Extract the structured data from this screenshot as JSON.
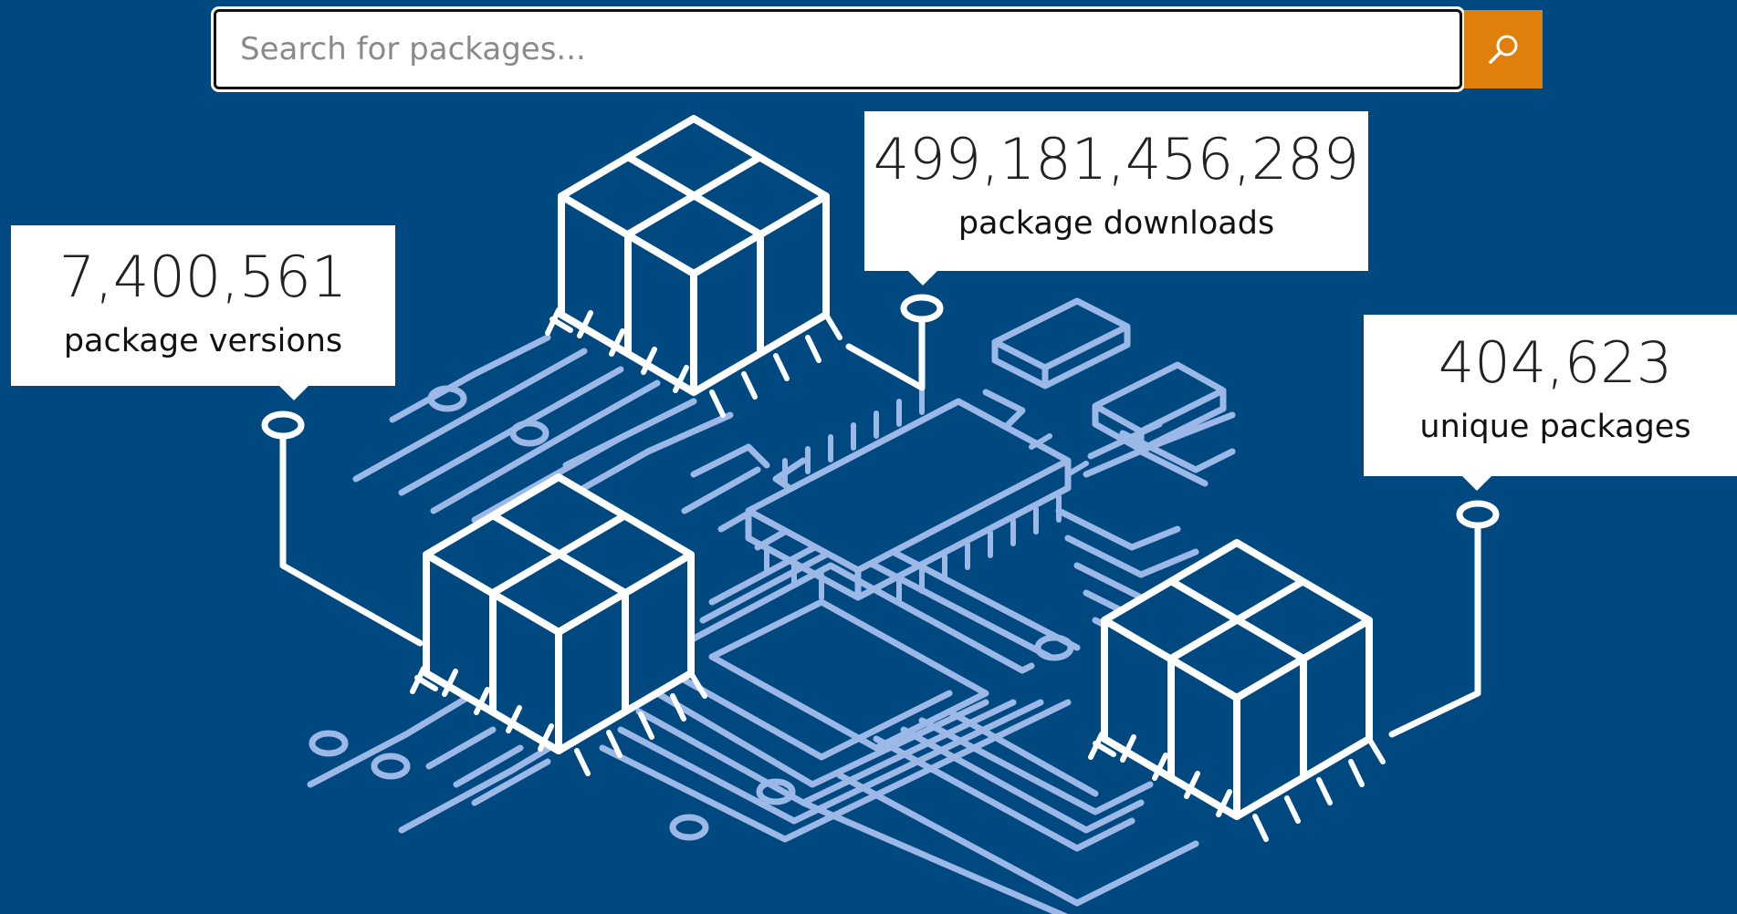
{
  "search": {
    "placeholder": "Search for packages..."
  },
  "stats": {
    "versions": {
      "value": "7,400,561",
      "label": "package versions"
    },
    "downloads": {
      "value": "499,181,456,289",
      "label": "package downloads"
    },
    "unique": {
      "value": "404,623",
      "label": "unique packages"
    }
  },
  "colors": {
    "background": "#004880",
    "search_button": "#e0800a",
    "circuit_light": "#9bb8e6",
    "outline": "#ffffff"
  },
  "icons": {
    "search_button": "search-icon",
    "hero": "package-circuit-illustration"
  }
}
